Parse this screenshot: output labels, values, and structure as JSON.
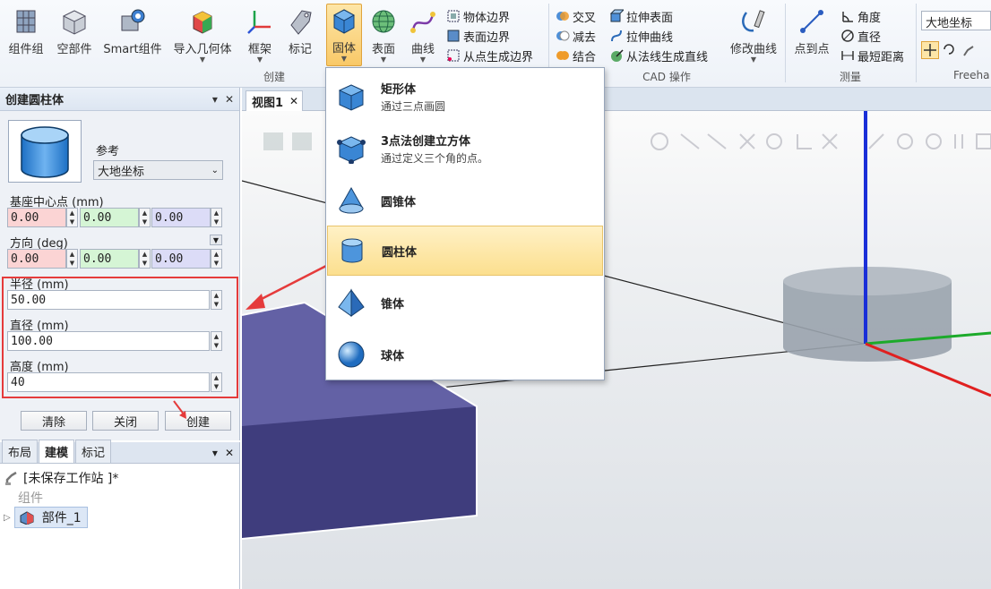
{
  "ribbon": {
    "create_group": {
      "label": "创建",
      "buttons": [
        "组件组",
        "空部件",
        "Smart组件",
        "导入几何体",
        "框架",
        "标记"
      ]
    },
    "solid_button": "固体",
    "surface_button": "表面",
    "curve_button": "曲线",
    "small_create": [
      "物体边界",
      "表面边界",
      "从点生成边界"
    ],
    "cad_group": {
      "label": "CAD 操作",
      "col1": [
        "交叉",
        "减去",
        "结合"
      ],
      "col2": [
        "拉伸表面",
        "拉伸曲线",
        "从法线生成直线"
      ],
      "modify_curve": "修改曲线"
    },
    "measure_group": {
      "label": "测量",
      "point_to_point": "点到点",
      "items": [
        "角度",
        "直径",
        "最短距离"
      ]
    },
    "freehand": {
      "coord_select": "大地坐标",
      "label": "Freeha"
    }
  },
  "dialog": {
    "title": "创建圆柱体",
    "reference_label": "参考",
    "reference_value": "大地坐标",
    "base_center_label": "基座中心点 (mm)",
    "base_center": [
      "0.00",
      "0.00",
      "0.00"
    ],
    "direction_label": "方向 (deg)",
    "direction": [
      "0.00",
      "0.00",
      "0.00"
    ],
    "radius_label": "半径 (mm)",
    "radius": "50.00",
    "diameter_label": "直径 (mm)",
    "diameter": "100.00",
    "height_label": "高度 (mm)",
    "height": "40",
    "btn_clear": "清除",
    "btn_close": "关闭",
    "btn_create": "创建"
  },
  "lower_panel": {
    "tabs": [
      "布局",
      "建模",
      "标记"
    ],
    "station": "[未保存工作站 ]*",
    "group_label": "组件",
    "part": "部件_1"
  },
  "view": {
    "tab": "视图1"
  },
  "menu": {
    "items": [
      {
        "title": "矩形体",
        "desc": "通过三点画圆"
      },
      {
        "title": "3点法创建立方体",
        "desc": "通过定义三个角的点。"
      },
      {
        "title": "圆锥体",
        "desc": ""
      },
      {
        "title": "圆柱体",
        "desc": ""
      },
      {
        "title": "锥体",
        "desc": ""
      },
      {
        "title": "球体",
        "desc": ""
      }
    ]
  },
  "colors": {
    "accent": "#f9c968",
    "highlight": "#e53b3b",
    "x_field": "#fbd4d4",
    "y_field": "#d5f5d5",
    "z_field": "#dcdcf7"
  }
}
